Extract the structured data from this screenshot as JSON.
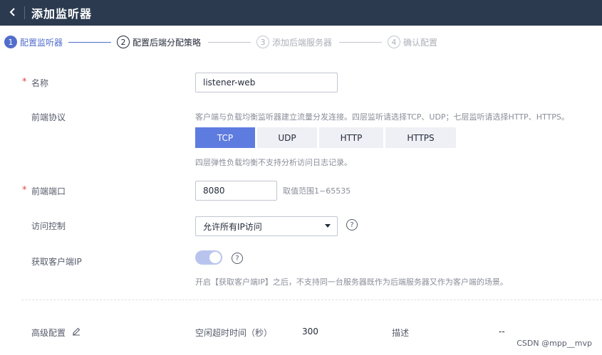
{
  "header": {
    "title": "添加监听器",
    "back_icon": "chevron-left-icon"
  },
  "steps": [
    {
      "num": "1",
      "label": "配置监听器",
      "state": "active"
    },
    {
      "num": "2",
      "label": "配置后端分配策略",
      "state": "current"
    },
    {
      "num": "3",
      "label": "添加后端服务器",
      "state": "pending"
    },
    {
      "num": "4",
      "label": "确认配置",
      "state": "pending"
    }
  ],
  "form": {
    "name": {
      "label": "名称",
      "value": "listener-web"
    },
    "protocol": {
      "label": "前端协议",
      "hint": "客户端与负载均衡监听器建立流量分发连接。四层监听请选择TCP、UDP；七层监听请选择HTTP、HTTPS。",
      "options": [
        "TCP",
        "UDP",
        "HTTP",
        "HTTPS"
      ],
      "selected": "TCP",
      "note": "四层弹性负载均衡不支持分析访问日志记录。"
    },
    "port": {
      "label": "前端端口",
      "value": "8080",
      "range": "取值范围1~65535"
    },
    "access": {
      "label": "访问控制",
      "value": "允许所有IP访问"
    },
    "client_ip": {
      "label": "获取客户端IP",
      "enabled": true,
      "note": "开启【获取客户端IP】之后，不支持同一台服务器既作为后端服务器又作为客户端的场景。"
    },
    "advanced": {
      "label": "高级配置",
      "idle_label": "空闲超时时间（秒）",
      "idle_value": "300",
      "desc_label": "描述",
      "desc_value": "--"
    }
  },
  "watermark": "CSDN @mpp__mvp",
  "colors": {
    "header_bg": "#2b3a4f",
    "accent": "#526ecc",
    "selected_bg": "#5e7ce0",
    "required": "#e5484d"
  }
}
